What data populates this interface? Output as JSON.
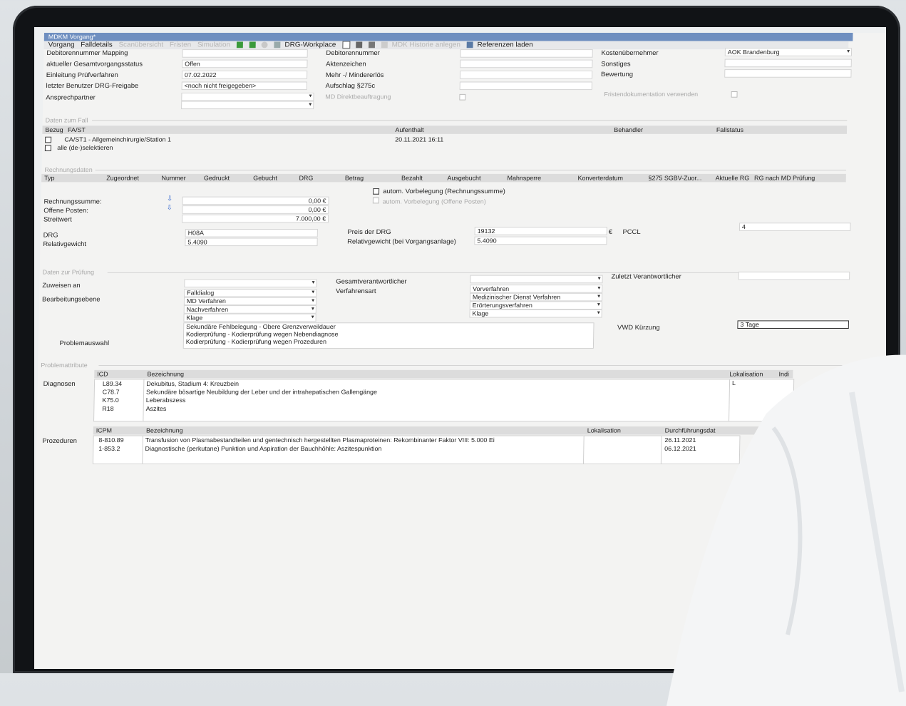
{
  "window": {
    "title": "MDKM Vorgang*"
  },
  "menu": {
    "items": [
      "Vorgang",
      "Falldetails",
      "Scanübersicht",
      "Fristen",
      "Simulation"
    ],
    "drg_workplace": "DRG-Workplace",
    "mdk_historie": "MDK Historie anlegen",
    "referenzen": "Referenzen laden"
  },
  "header": {
    "debitorennummer_mapping_label": "Debitorennummer Mapping",
    "gesamtstatus_label": "aktueller Gesamtvorgangsstatus",
    "gesamtstatus_value": "Offen",
    "einleitung_label": "Einleitung Prüfverfahren",
    "einleitung_value": "07.02.2022",
    "benutzer_label": "letzter Benutzer DRG-Freigabe",
    "benutzer_value": "<noch nicht freigegeben>",
    "ansprechpartner_label": "Ansprechpartner",
    "debitorennummer_label": "Debitorennummer",
    "aktenzeichen_label": "Aktenzeichen",
    "mehr_minder_label": "Mehr -/ Mindererlös",
    "aufschlag_label": "Aufschlag §275c",
    "md_direkt_label": "MD Direktbeauftragung",
    "kostentraeger_label": "Kostenübernehmer",
    "kostentraeger_value": "AOK Brandenburg",
    "sonstiges_label": "Sonstiges",
    "bewertung_label": "Bewertung",
    "fristen_label": "Fristendokumentation verwenden"
  },
  "fall": {
    "section": "Daten zum Fall",
    "columns": [
      "Bezug",
      "FA/ST",
      "Aufenthalt",
      "Behandler",
      "Fallstatus"
    ],
    "row_label": "CA/ST1 - Allgemeinchirurgie/Station 1",
    "row_aufenthalt": "20.11.2021  16:11",
    "select_all": "alle (de-)selektieren"
  },
  "rechnung": {
    "section": "Rechnungsdaten",
    "columns": [
      "Typ",
      "Zugeordnet",
      "Nummer",
      "Gedruckt",
      "Gebucht",
      "DRG",
      "Betrag",
      "Bezahlt",
      "Ausgebucht",
      "Mahnsperre",
      "Konverterdatum",
      "§275 SGBV-Zuor...",
      "Aktuelle RG",
      "RG nach MD Prüfung"
    ],
    "summe_label": "Rechnungssumme:",
    "summe_value": "0,00 €",
    "offen_label": "Offene Posten:",
    "offen_value": "0,00 €",
    "streitwert_label": "Streitwert",
    "streitwert_value": "7.000,00 €",
    "vorbelegung1": "autom. Vorbelegung (Rechnungssumme)",
    "vorbelegung2": "autom. Vorbelegung (Offene Posten)",
    "drg_label": "DRG",
    "drg_value": "H08A",
    "rg_label": "Relativgewicht",
    "rg_value": "5.4090",
    "preis_label": "Preis der DRG",
    "preis_value": "19132",
    "preis_unit": "€",
    "pccl_label": "PCCL",
    "pccl_value": "4",
    "rg_vorgang_label": "Relativgewicht (bei Vorgangsanlage)",
    "rg_vorgang_value": "5.4090"
  },
  "pruefung": {
    "section": "Daten zur Prüfung",
    "zuweisen_label": "Zuweisen an",
    "bearbeitung_label": "Bearbeitungsebene",
    "bearbeitung_values": [
      "Falldialog",
      "MD Verfahren",
      "Nachverfahren",
      "Klage"
    ],
    "gesamt_label": "Gesamtverantwortlicher",
    "verfahren_label": "Verfahrensart",
    "verfahren_values": [
      "Vorverfahren",
      "Medizinischer Dienst Verfahren",
      "Erörterungsverfahren",
      "Klage"
    ],
    "zuletzt_label": "Zuletzt Verantwortlicher",
    "vwd_label": "VWD Kürzung",
    "vwd_value": "3 Tage",
    "problem_label": "Problemauswahl",
    "problems": [
      "Sekundäre Fehlbelegung - Obere Grenzverweildauer",
      "Kodierprüfung - Kodierprüfung wegen Nebendiagnose",
      "Kodierprüfung - Kodierprüfung wegen Prozeduren"
    ]
  },
  "problemattribute": {
    "section": "Problemattribute",
    "diag_label": "Diagnosen",
    "icd_col": "ICD",
    "bez_col": "Bezeichnung",
    "lok_col": "Lokalisation",
    "indi_col": "Indi",
    "lok_value": "L",
    "diagnosen": [
      {
        "code": "L89.34",
        "text": "Dekubitus, Stadium 4: Kreuzbein"
      },
      {
        "code": "C78.7",
        "text": "Sekundäre bösartige Neubildung der Leber und der intrahepatischen Gallengänge"
      },
      {
        "code": "K75.0",
        "text": "Leberabszess"
      },
      {
        "code": "R18",
        "text": "Aszites"
      }
    ],
    "proz_label": "Prozeduren",
    "icpm_col": "ICPM",
    "durch_col": "Durchführungsdat",
    "prozeduren": [
      {
        "code": "8-810.89",
        "text": "Transfusion von Plasmabestandteilen und gentechnisch hergestellten Plasmaproteinen: Rekombinanter Faktor VIII: 5.000 Ei",
        "date": "26.11.2021"
      },
      {
        "code": "1-853.2",
        "text": "Diagnostische (perkutane) Punktion und Aspiration der Bauchhöhle: Aszitespunktion",
        "date": "06.12.2021"
      }
    ]
  }
}
